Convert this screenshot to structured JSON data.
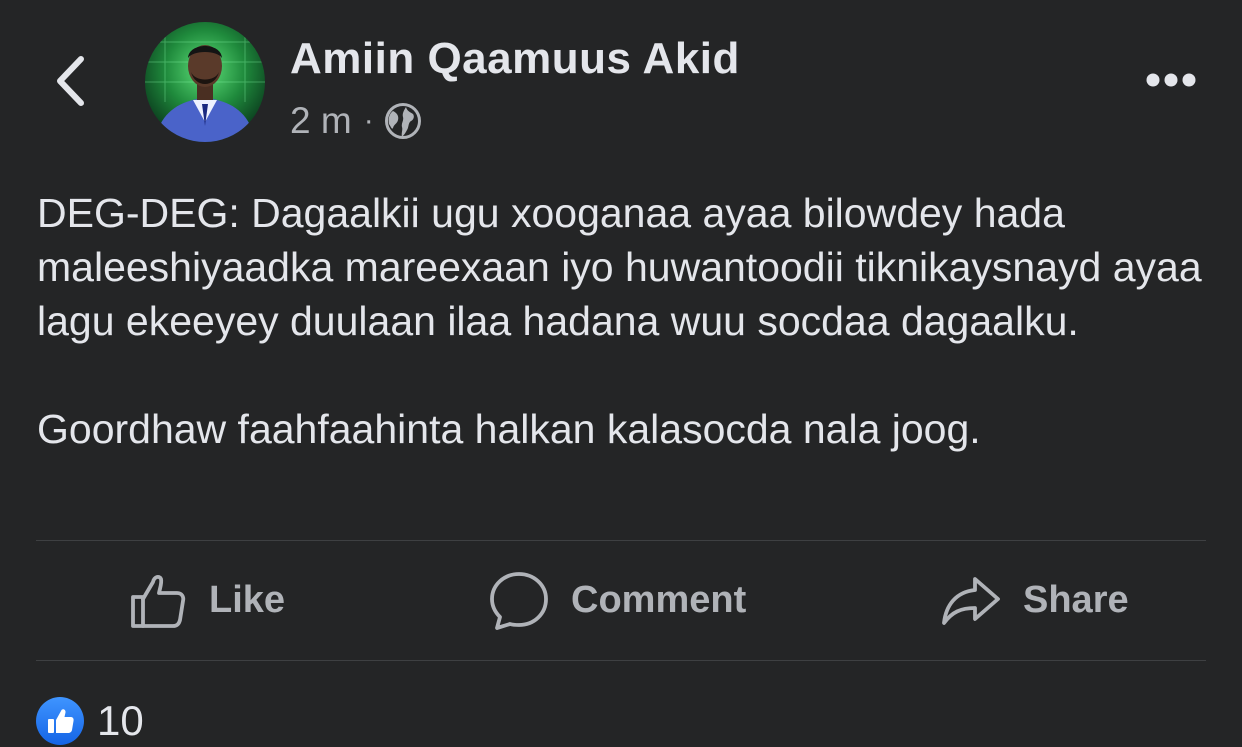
{
  "header": {
    "back_icon": "chevron-left-icon",
    "author_name": "Amiin Qaamuus Akid",
    "timestamp": "2 m",
    "separator": "·",
    "audience_icon": "globe-icon",
    "more_icon": "more-horizontal-icon"
  },
  "post": {
    "paragraphs": [
      "DEG-DEG: Dagaalkii ugu xooganaa ayaa bilowdey hada maleeshiyaadka mareexaan iyo huwantoodii tiknikaysnayd ayaa lagu ekeeyey duulaan ilaa hadana wuu socdaa dagaalku.",
      "Goordhaw faahfaahinta halkan kalasocda nala joog."
    ]
  },
  "actions": {
    "like_label": "Like",
    "comment_label": "Comment",
    "share_label": "Share"
  },
  "reactions": {
    "icon": "thumbs-up-icon",
    "count": "10"
  },
  "colors": {
    "background": "#242526",
    "primary_text": "#e4e6eb",
    "secondary_text": "#b0b3b8",
    "divider": "#3e4042",
    "like_blue": "#1877f2"
  }
}
